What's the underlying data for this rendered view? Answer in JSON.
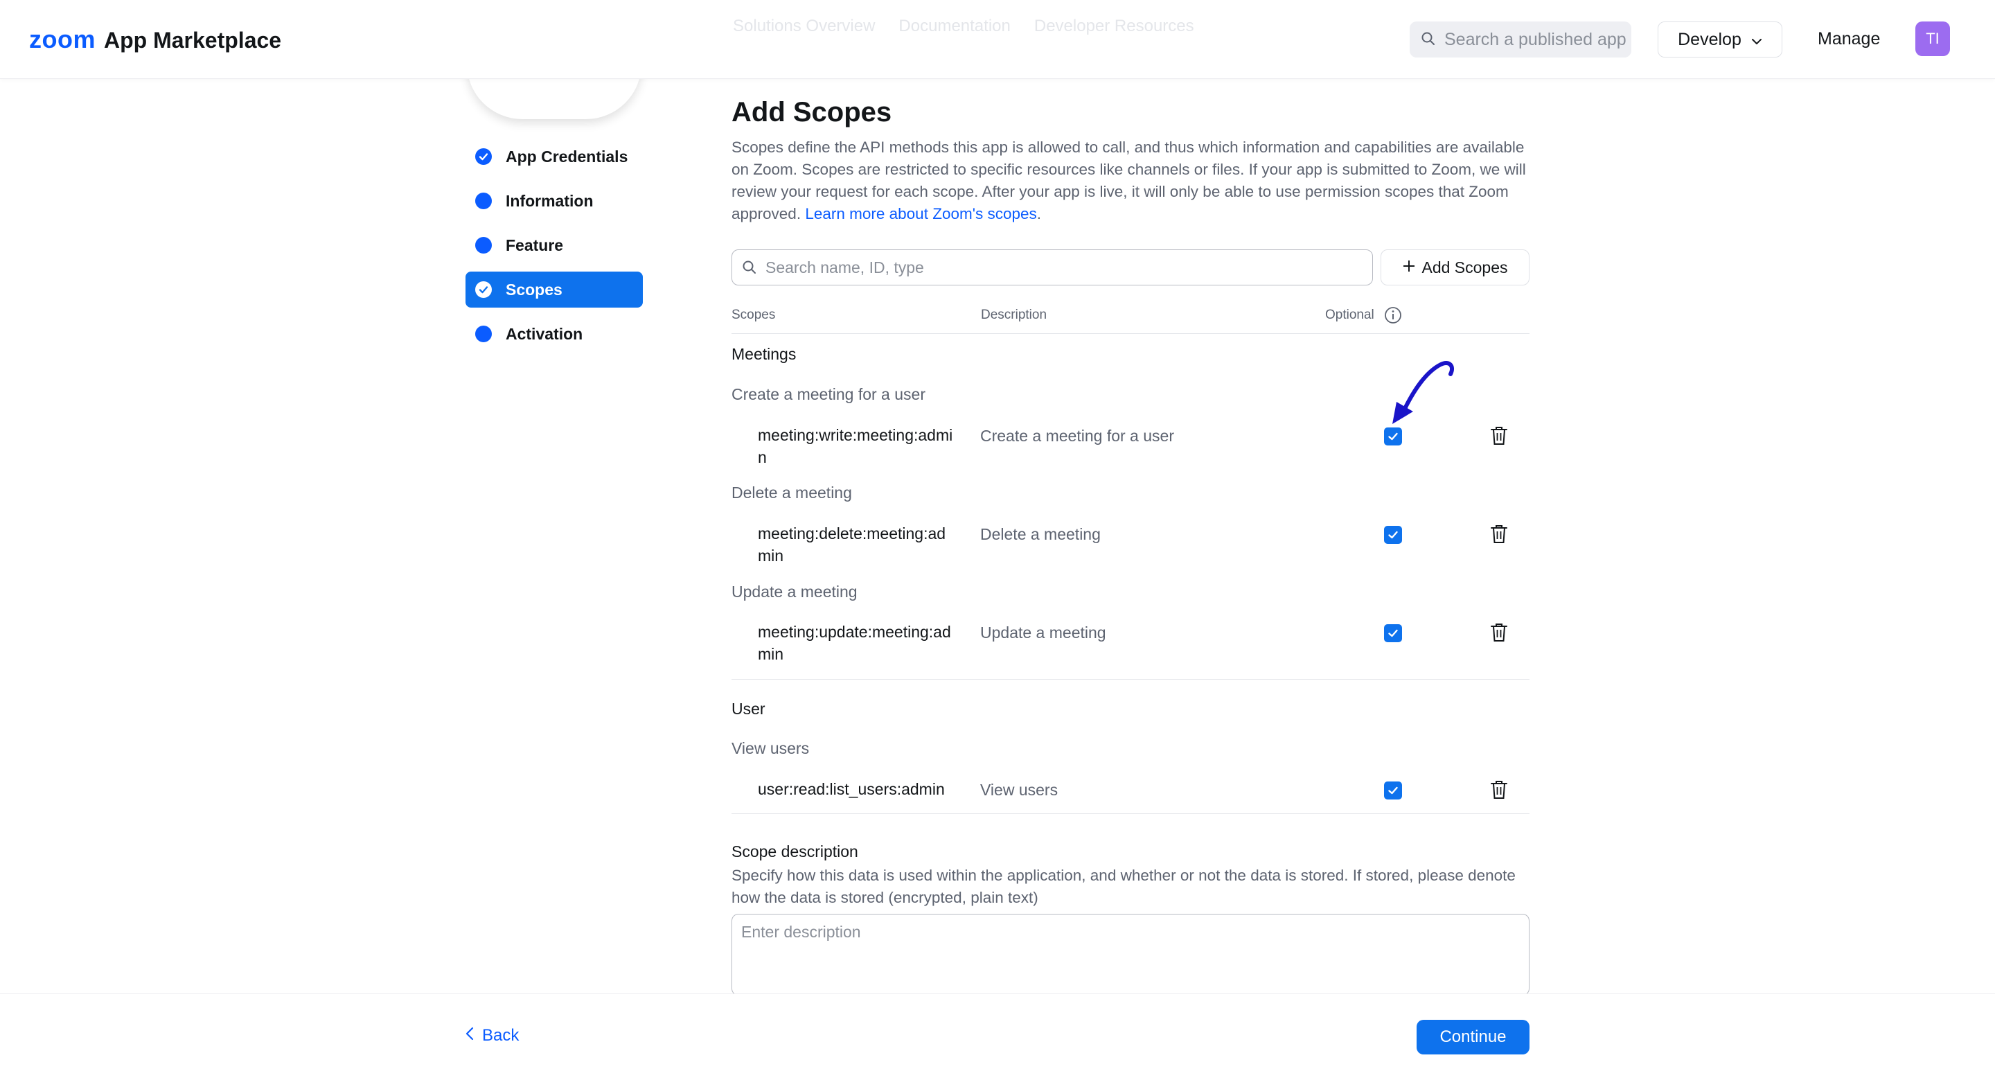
{
  "header": {
    "logo_brand": "zoom",
    "logo_title": "App Marketplace",
    "ghost_tabs": [
      "Solutions Overview",
      "Documentation",
      "Developer Resources"
    ],
    "search_placeholder": "Search a published app",
    "develop_label": "Develop",
    "manage_label": "Manage",
    "avatar_initials": "TI"
  },
  "sidebar": {
    "items": [
      {
        "label": "App Credentials",
        "state": "completed"
      },
      {
        "label": "Information",
        "state": "pending"
      },
      {
        "label": "Feature",
        "state": "pending"
      },
      {
        "label": "Scopes",
        "state": "active"
      },
      {
        "label": "Activation",
        "state": "pending"
      }
    ]
  },
  "main": {
    "title": "Add Scopes",
    "intro": "Scopes define the API methods this app is allowed to call, and thus which information and capabilities are available on Zoom. Scopes are restricted to specific resources like channels or files. If your app is submitted to Zoom, we will review your request for each scope. After your app is live, it will only be able to use permission scopes that Zoom approved. ",
    "intro_link": "Learn more about Zoom's scopes",
    "intro_end": ".",
    "scope_search_placeholder": "Search name, ID, type",
    "add_scopes_label": "Add Scopes",
    "columns": {
      "scopes": "Scopes",
      "description": "Description",
      "optional": "Optional"
    },
    "groups": [
      {
        "title": "Meetings",
        "entries": [
          {
            "subtitle": "Create a meeting for a user",
            "scope": "meeting:write:meeting:admin",
            "description": "Create a meeting for a user",
            "optional": true
          },
          {
            "subtitle": "Delete a meeting",
            "scope": "meeting:delete:meeting:admin",
            "description": "Delete a meeting",
            "optional": true
          },
          {
            "subtitle": "Update a meeting",
            "scope": "meeting:update:meeting:admin",
            "description": "Update a meeting",
            "optional": true
          }
        ]
      },
      {
        "title": "User",
        "entries": [
          {
            "subtitle": "View users",
            "scope": "user:read:list_users:admin",
            "description": "View users",
            "optional": true
          }
        ]
      }
    ],
    "scope_description": {
      "title": "Scope description",
      "help": "Specify how this data is used within the application, and whether or not the data is stored. If stored, please denote how the data is stored (encrypted, plain text)",
      "placeholder": "Enter description"
    }
  },
  "footer": {
    "back_label": "Back",
    "continue_label": "Continue"
  },
  "colors": {
    "brand_blue": "#0b5cff",
    "active_blue": "#0e72ed",
    "annotation_arrow": "#1a14c8",
    "avatar": "#9c6cf0"
  }
}
